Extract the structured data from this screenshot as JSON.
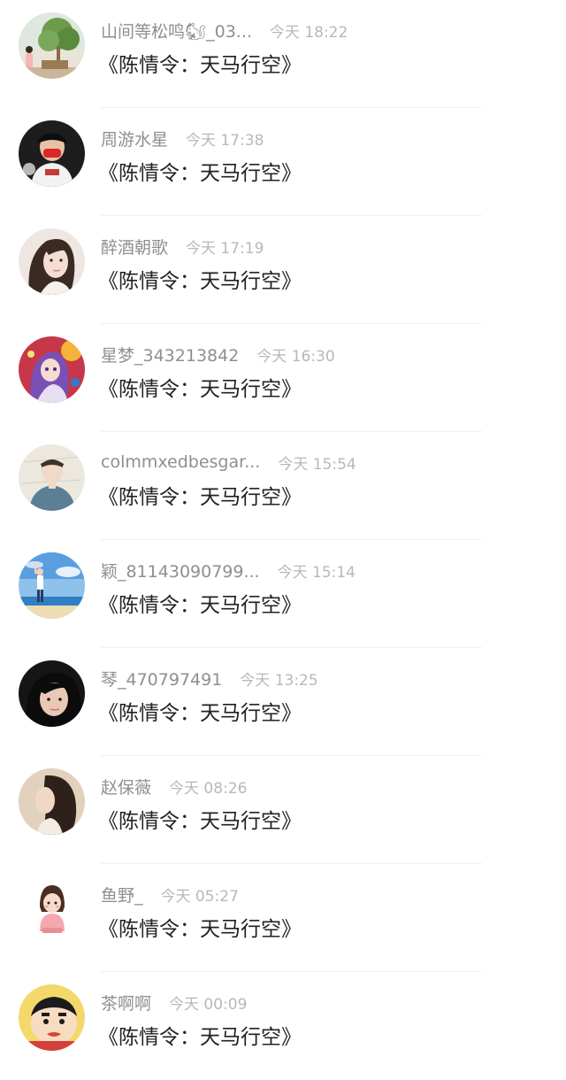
{
  "comments": [
    {
      "name": "山间等松鸣🐿_03...",
      "time": "今天 18:22",
      "text": "《陈情令：天马行空》",
      "avatar": "tree-avatar"
    },
    {
      "name": "周游水星",
      "time": "今天 17:38",
      "text": "《陈情令：天马行空》",
      "avatar": "masked-person-avatar"
    },
    {
      "name": "醉酒朝歌",
      "time": "今天 17:19",
      "text": "《陈情令：天马行空》",
      "avatar": "woman-portrait-avatar"
    },
    {
      "name": "星梦_343213842",
      "time": "今天 16:30",
      "text": "《陈情令：天马行空》",
      "avatar": "anime-girl-avatar"
    },
    {
      "name": "colmmxedbesgar...",
      "time": "今天 15:54",
      "text": "《陈情令：天马行空》",
      "avatar": "illustrated-boy-avatar"
    },
    {
      "name": "颖_81143090799...",
      "time": "今天 15:14",
      "text": "《陈情令：天马行空》",
      "avatar": "beach-figure-avatar"
    },
    {
      "name": "琴_470797491",
      "time": "今天 13:25",
      "text": "《陈情令：天马行空》",
      "avatar": "dark-selfie-avatar"
    },
    {
      "name": "赵保薇",
      "time": "今天 08:26",
      "text": "《陈情令：天马行空》",
      "avatar": "long-hair-profile-avatar"
    },
    {
      "name": "鱼野_",
      "time": "今天 05:27",
      "text": "《陈情令：天马行空》",
      "avatar": "cartoon-girl-avatar"
    },
    {
      "name": "茶啊啊",
      "time": "今天 00:09",
      "text": "《陈情令：天马行空》",
      "avatar": "crayon-shinchan-avatar"
    }
  ]
}
